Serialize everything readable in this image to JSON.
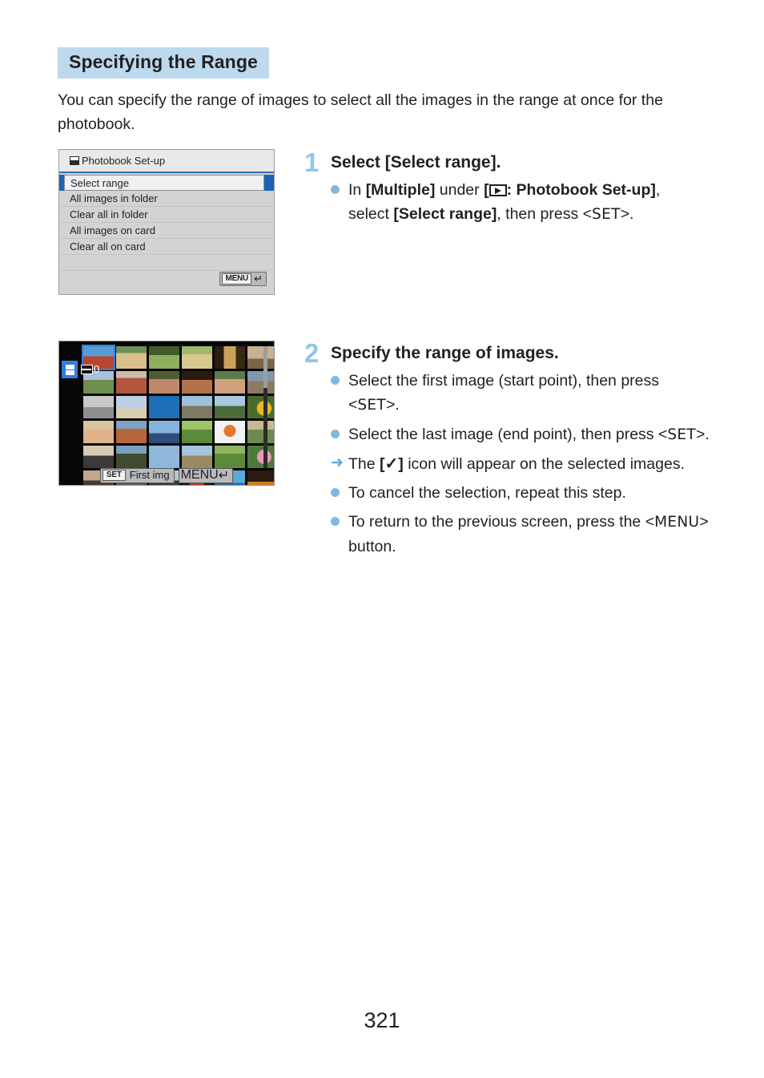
{
  "heading": "Specifying the Range",
  "intro": "You can specify the range of images to select all the images in the range at once for the photobook.",
  "menu_screen": {
    "title": "Photobook Set-up",
    "title_icon": "photobook-icon",
    "items": [
      "Select range",
      "All images in folder",
      "Clear all in folder",
      "All images on card",
      "Clear all on card"
    ],
    "selected_index": 0,
    "menu_button_label": "MENU",
    "menu_button_icon": "return-arrow-icon"
  },
  "thumb_screen": {
    "selection_count": "0",
    "selection_badge_icon": "photobook-badge-icon",
    "set_button_label": "SET",
    "set_action_label": "First img",
    "menu_button_label": "MENU",
    "menu_button_icon": "return-arrow-icon"
  },
  "steps": [
    {
      "number": "1",
      "title": "Select [Select range].",
      "bullets": [
        {
          "marker": "dot",
          "parts": [
            {
              "t": "In ",
              "b": false
            },
            {
              "t": "[Multiple]",
              "b": true
            },
            {
              "t": " under ",
              "b": false
            },
            {
              "t": "[",
              "b": true
            },
            {
              "t": "PLAYBACK_ICON",
              "b": false
            },
            {
              "t": ": Photobook Set-up]",
              "b": true
            },
            {
              "t": ", select ",
              "b": false
            },
            {
              "t": "[Select range]",
              "b": true
            },
            {
              "t": ", then press <SET>.",
              "b": false
            }
          ]
        }
      ]
    },
    {
      "number": "2",
      "title": "Specify the range of images.",
      "bullets": [
        {
          "marker": "dot",
          "text": "Select the first image (start point), then press <SET>."
        },
        {
          "marker": "dot",
          "text": "Select the last image (end point), then press <SET>."
        },
        {
          "marker": "arrow",
          "text": "The [✓] icon will appear on the selected images."
        },
        {
          "marker": "dot",
          "text": "To cancel the selection, repeat this step."
        },
        {
          "marker": "dot",
          "text": "To return to the previous screen, press the <MENU> button."
        }
      ]
    }
  ],
  "page_number": "321",
  "colors": {
    "heading_bg": "#bcd9ee",
    "step_number": "#93c5e8",
    "bullet": "#7fb9e3",
    "menu_selected": "#1f63b8"
  }
}
